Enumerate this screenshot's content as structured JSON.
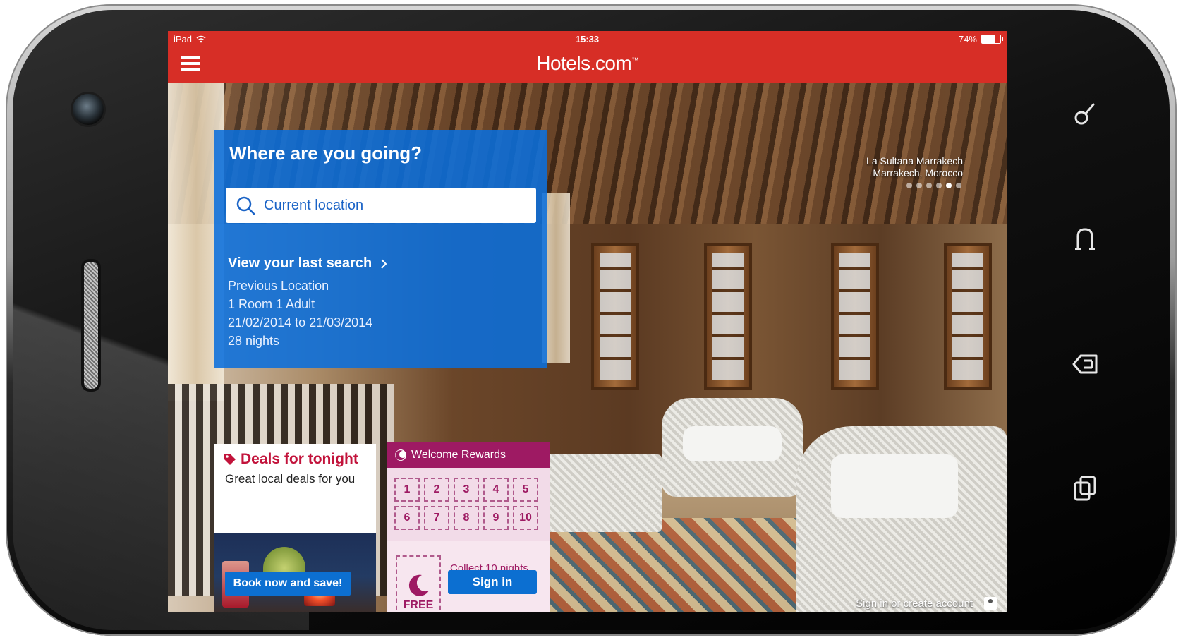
{
  "status_bar": {
    "device": "iPad",
    "time": "15:33",
    "battery": "74%",
    "battery_level": 0.74
  },
  "app": {
    "logo": "Hotels.com",
    "logo_mark": "™"
  },
  "hero": {
    "hotel_name": "La Sultana Marrakech",
    "hotel_location": "Marrakech, Morocco",
    "carousel_dots": 6,
    "carousel_active_index": 4
  },
  "search": {
    "title": "Where are you going?",
    "placeholder": "Current location",
    "last_search_label": "View your last search",
    "last_search_lines": [
      "Previous Location",
      "1 Room 1 Adult",
      "21/02/2014 to 21/03/2014",
      "28 nights"
    ]
  },
  "deals": {
    "title": "Deals for tonight",
    "subtitle": "Great local deals for you",
    "button": "Book now and save!"
  },
  "rewards": {
    "title": "Welcome Rewards",
    "stamps": [
      "1",
      "2",
      "3",
      "4",
      "5",
      "6",
      "7",
      "8",
      "9",
      "10"
    ],
    "free_label": "FREE",
    "collect_text": "Collect 10 nights get 1 free*",
    "signin_button": "Sign in"
  },
  "footer": {
    "signin_link": "Sign in or create account"
  },
  "colors": {
    "brand_red": "#d72e26",
    "search_blue": "#0a6edc",
    "rewards_purple": "#9e1a63",
    "deals_red": "#c2133b",
    "button_blue": "#0c6fd1"
  },
  "side_buttons": [
    "search-icon",
    "home-icon",
    "back-icon",
    "recent-apps-icon"
  ]
}
